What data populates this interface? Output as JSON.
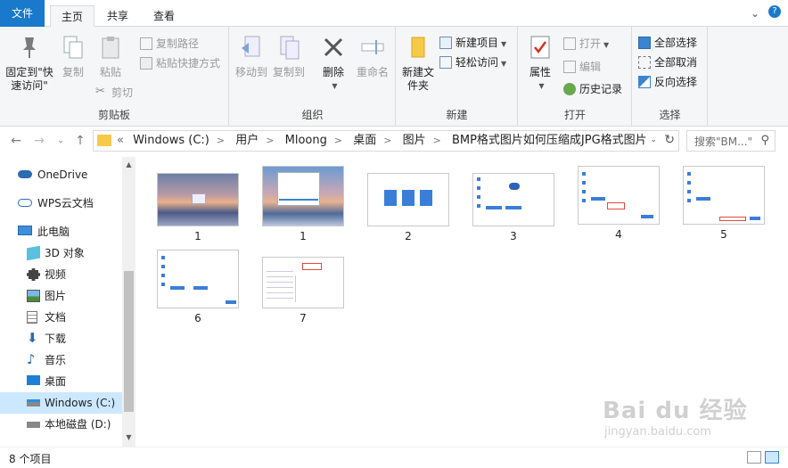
{
  "tabs": {
    "file": "文件",
    "home": "主页",
    "share": "共享",
    "view": "查看"
  },
  "ribbon": {
    "clipboard": {
      "label": "剪贴板",
      "pin": "固定到\"快速访问\"",
      "copy": "复制",
      "paste": "粘贴",
      "copy_path": "复制路径",
      "paste_shortcut": "粘贴快捷方式",
      "cut": "剪切"
    },
    "organize": {
      "label": "组织",
      "move_to": "移动到",
      "copy_to": "复制到",
      "delete": "删除",
      "rename": "重命名"
    },
    "new": {
      "label": "新建",
      "new_folder": "新建文件夹",
      "new_item": "新建项目",
      "easy_access": "轻松访问"
    },
    "open": {
      "label": "打开",
      "properties": "属性",
      "open": "打开",
      "edit": "编辑",
      "history": "历史记录"
    },
    "select": {
      "label": "选择",
      "select_all": "全部选择",
      "select_none": "全部取消",
      "invert": "反向选择"
    }
  },
  "address": {
    "crumbs": [
      "Windows (C:)",
      "用户",
      "Mloong",
      "桌面",
      "图片",
      "BMP格式图片如何压缩成JPG格式图片"
    ],
    "search_placeholder": "搜索\"BM...\""
  },
  "sidebar": {
    "items": [
      {
        "label": "OneDrive"
      },
      {
        "label": "WPS云文档"
      },
      {
        "label": "此电脑"
      },
      {
        "label": "3D 对象"
      },
      {
        "label": "视频"
      },
      {
        "label": "图片"
      },
      {
        "label": "文档"
      },
      {
        "label": "下载"
      },
      {
        "label": "音乐"
      },
      {
        "label": "桌面"
      },
      {
        "label": "Windows (C:)"
      },
      {
        "label": "本地磁盘 (D:)"
      }
    ]
  },
  "files": [
    {
      "name": "1"
    },
    {
      "name": "1"
    },
    {
      "name": "2"
    },
    {
      "name": "3"
    },
    {
      "name": "4"
    },
    {
      "name": "5"
    },
    {
      "name": "6"
    },
    {
      "name": "7"
    }
  ],
  "status": {
    "count": "8 个项目"
  },
  "watermark": {
    "brand": "Bai du 经验",
    "url": "jingyan.baidu.com"
  },
  "colors": {
    "accent": "#1979ca",
    "selected": "#cce8ff",
    "folder": "#f7c948"
  }
}
